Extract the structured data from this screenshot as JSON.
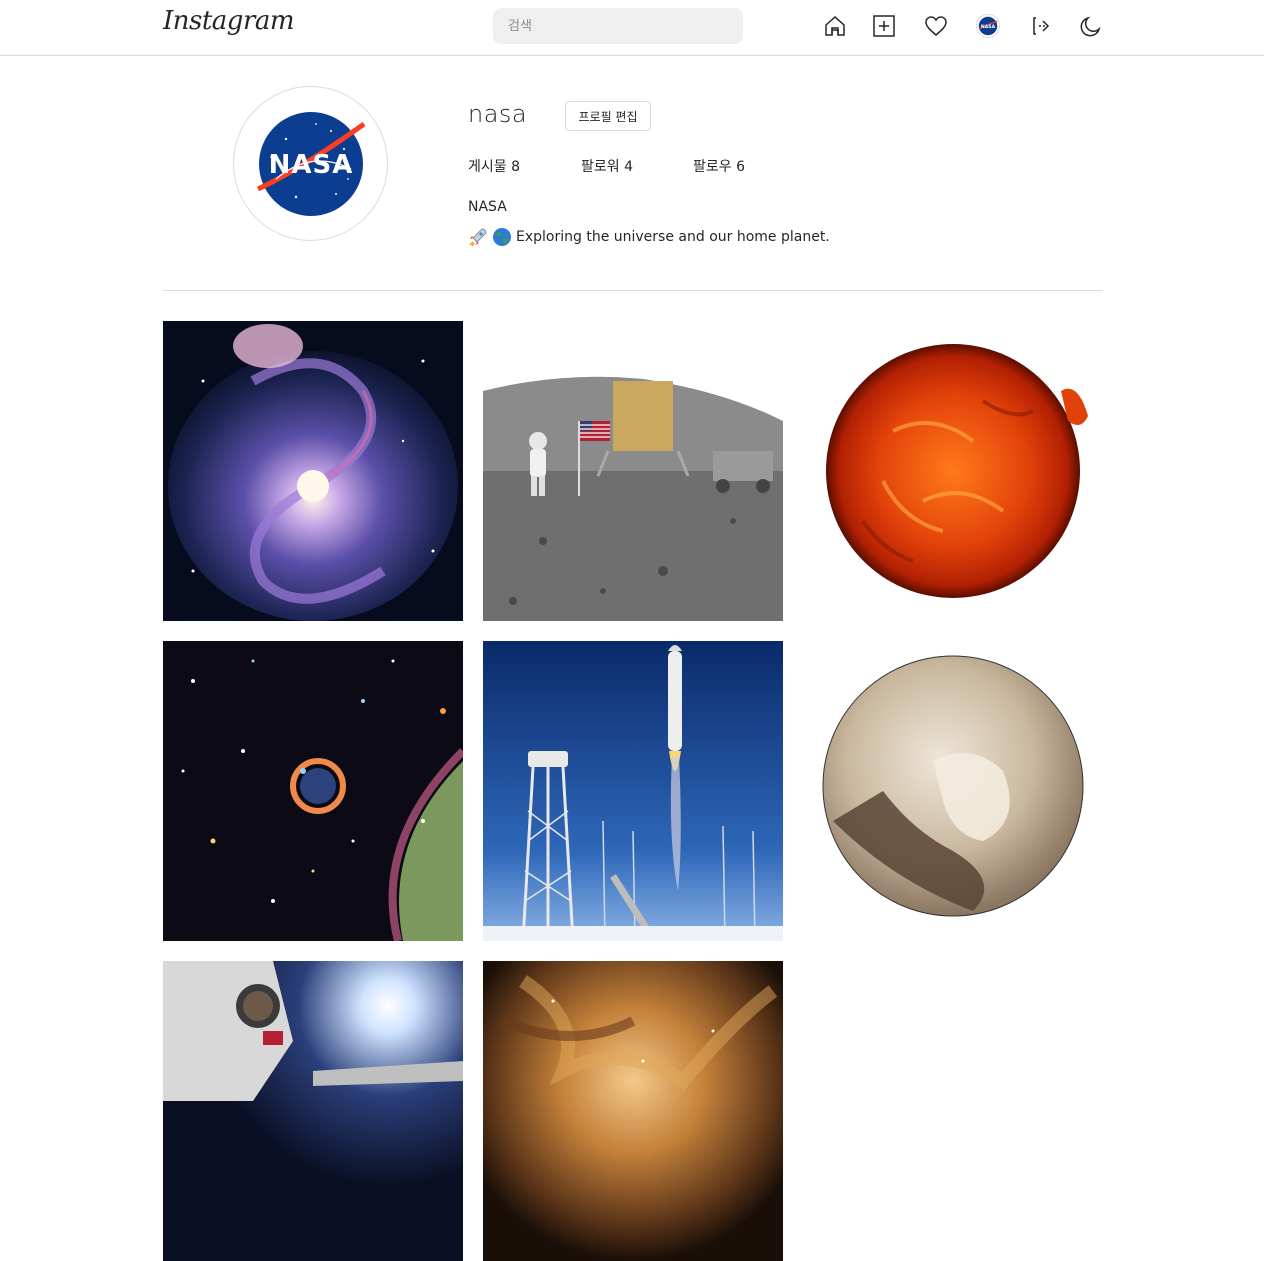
{
  "header": {
    "logo_text": "Instagram",
    "search_placeholder": "검색",
    "icons": [
      "home-icon",
      "new-post-icon",
      "activity-heart-icon",
      "profile-avatar-icon",
      "logout-icon",
      "dark-mode-moon-icon"
    ]
  },
  "profile": {
    "username": "nasa",
    "edit_button_label": "프로필 편집",
    "stats": {
      "posts_label": "게시물 8",
      "followers_label": "팔로워 4",
      "following_label": "팔로우 6"
    },
    "full_name": "NASA",
    "bio_text": "Exploring the universe and our home planet.",
    "bio_emojis": [
      "rocket-emoji",
      "earth-emoji"
    ],
    "avatar_logo_text": "NASA"
  },
  "posts": [
    {
      "subject": "spiral-galaxy"
    },
    {
      "subject": "moon-landing"
    },
    {
      "subject": "sun"
    },
    {
      "subject": "supernova-remnant"
    },
    {
      "subject": "rocket-launch"
    },
    {
      "subject": "pluto"
    },
    {
      "subject": "astronaut-spacewalk"
    },
    {
      "subject": "nebula"
    }
  ],
  "colors": {
    "border": "#dbdbdb",
    "text": "#262626",
    "search_bg": "#efefef",
    "nasa_blue": "#0b3d91",
    "nasa_red": "#fc3d21"
  }
}
